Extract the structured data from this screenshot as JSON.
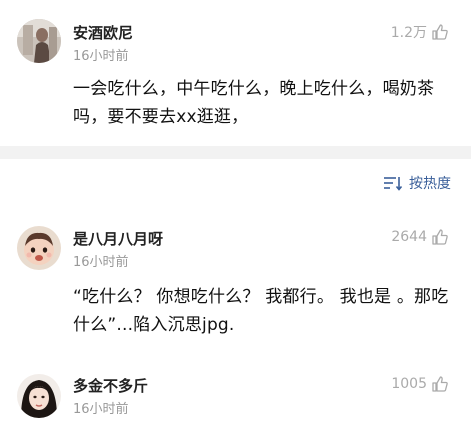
{
  "comments": [
    {
      "username": "安酒欧尼",
      "time": "16小时前",
      "likes": "1.2万",
      "text": "一会吃什么，中午吃什么，晚上吃什么，喝奶茶吗，要不要去xx逛逛，"
    },
    {
      "username": "是八月八月呀",
      "time": "16小时前",
      "likes": "2644",
      "text": "“吃什么？ 你想吃什么？ 我都行。 我也是 。那吃什么”...陷入沉思jpg."
    },
    {
      "username": "多金不多斤",
      "time": "16小时前",
      "likes": "1005",
      "text": ""
    }
  ],
  "sort": {
    "label": "按热度",
    "icon": "sort-icon"
  },
  "icons": {
    "like": "thumbs-up-icon"
  },
  "colors": {
    "link_blue": "#3a5f9a",
    "muted": "#999999",
    "divider": "#f2f2f2"
  }
}
